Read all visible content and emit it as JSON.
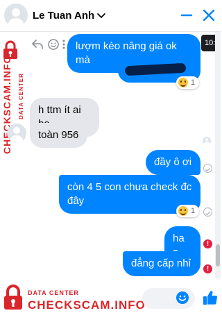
{
  "header": {
    "contact_name": "Le Tuan Anh",
    "icons": [
      "chevron-down-icon",
      "minimize-icon",
      "close-icon"
    ]
  },
  "time_badge": "10:",
  "watermark": {
    "sub": "DATA CENTER",
    "main": "CHECKSCAM.INFO"
  },
  "messages": [
    {
      "id": "m1",
      "direction": "outgoing",
      "text": "lượm kèo nâng giá ok mà"
    },
    {
      "id": "m2",
      "direction": "outgoing",
      "text": "",
      "redacted": true,
      "reaction": {
        "emoji": "laughing-emoji",
        "count": "1"
      }
    },
    {
      "id": "m3",
      "direction": "incoming",
      "text": "h ttm ít ai bọ"
    },
    {
      "id": "m4",
      "direction": "incoming",
      "text": "toàn 956"
    },
    {
      "id": "m5",
      "direction": "outgoing",
      "text": "đầy ô ơi",
      "status": "sent"
    },
    {
      "id": "m6",
      "direction": "outgoing",
      "text": "còn 4 5 con chưa check đc đây",
      "reaction": {
        "emoji": "laughing-emoji",
        "count": "1"
      },
      "status": "sent"
    },
    {
      "id": "m7",
      "direction": "outgoing",
      "text": "ha a",
      "status": "error"
    },
    {
      "id": "m8",
      "direction": "outgoing",
      "text": "đẳng cấp nhỉ",
      "status": "error"
    }
  ],
  "status_glyphs": {
    "error": "!"
  },
  "colors": {
    "accent": "#0084ff",
    "incoming": "#e4e6eb",
    "error": "#e41e3f",
    "watermark": "#d9262b"
  }
}
